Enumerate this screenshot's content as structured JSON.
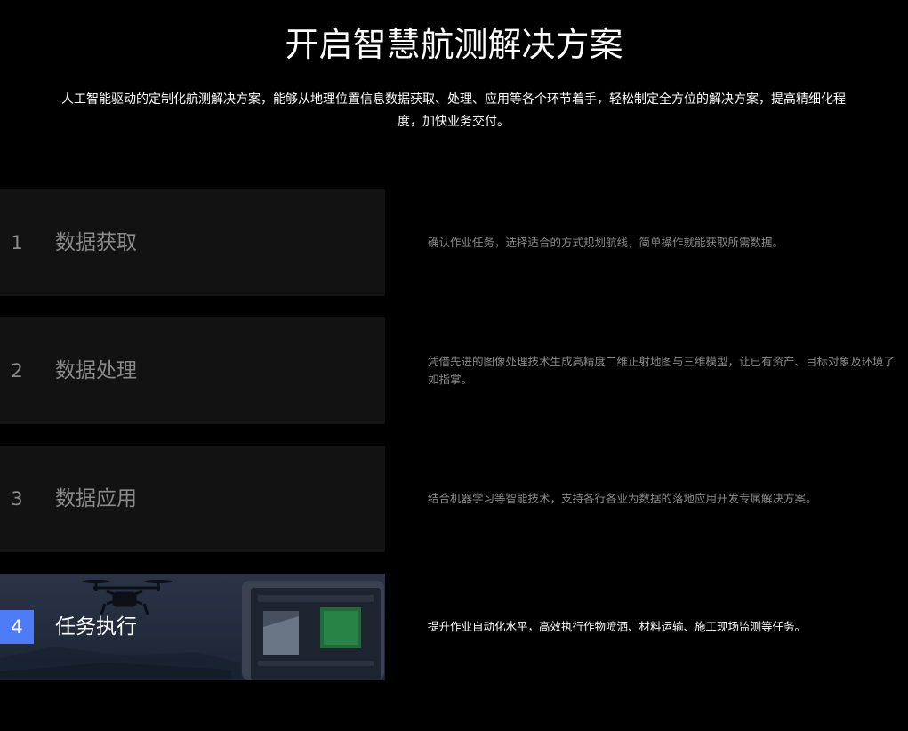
{
  "header": {
    "title": "开启智慧航测解决方案",
    "subtitle": "人工智能驱动的定制化航测解决方案，能够从地理位置信息数据获取、处理、应用等各个环节着手，轻松制定全方位的解决方案，提高精细化程度，加快业务交付。"
  },
  "steps": [
    {
      "number": "1",
      "label": "数据获取",
      "description": "确认作业任务，选择适合的方式规划航线，简单操作就能获取所需数据。"
    },
    {
      "number": "2",
      "label": "数据处理",
      "description": "凭借先进的图像处理技术生成高精度二维正射地图与三维模型，让已有资产、目标对象及环境了如指掌。"
    },
    {
      "number": "3",
      "label": "数据应用",
      "description": "结合机器学习等智能技术，支持各行各业为数据的落地应用开发专属解决方案。"
    },
    {
      "number": "4",
      "label": "任务执行",
      "description": "提升作业自动化水平，高效执行作物喷洒、材料运输、施工现场监测等任务。"
    }
  ],
  "active_step": 4,
  "colors": {
    "accent": "#4d7cf6",
    "background": "#000000",
    "card": "#121212",
    "muted_text": "#8a8a8a"
  },
  "icons": {
    "step4_background": "drone-and-tablet-image"
  }
}
